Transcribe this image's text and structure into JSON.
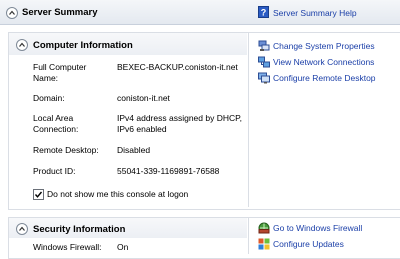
{
  "header": {
    "title": "Server Summary",
    "help_link": "Server Summary Help"
  },
  "computer_info": {
    "title": "Computer Information",
    "fields": [
      {
        "label": "Full Computer Name:",
        "value": "BEXEC-BACKUP.coniston-it.net"
      },
      {
        "label": "Domain:",
        "value": "coniston-it.net"
      },
      {
        "label": "Local Area Connection:",
        "value": "IPv4 address assigned by DHCP, IPv6 enabled"
      },
      {
        "label": "Remote Desktop:",
        "value": "Disabled"
      },
      {
        "label": "Product ID:",
        "value": "55041-339-1169891-76588"
      }
    ],
    "checkbox_label": "Do not show me this console at logon",
    "checkbox_checked": true,
    "links": [
      {
        "label": "Change System Properties",
        "icon": "system-properties-icon"
      },
      {
        "label": "View Network Connections",
        "icon": "network-connections-icon"
      },
      {
        "label": "Configure Remote Desktop",
        "icon": "remote-desktop-icon"
      }
    ]
  },
  "security_info": {
    "title": "Security Information",
    "fields": [
      {
        "label": "Windows Firewall:",
        "value": "On"
      }
    ],
    "links": [
      {
        "label": "Go to Windows Firewall",
        "icon": "firewall-icon"
      },
      {
        "label": "Configure Updates",
        "icon": "updates-icon"
      }
    ]
  }
}
